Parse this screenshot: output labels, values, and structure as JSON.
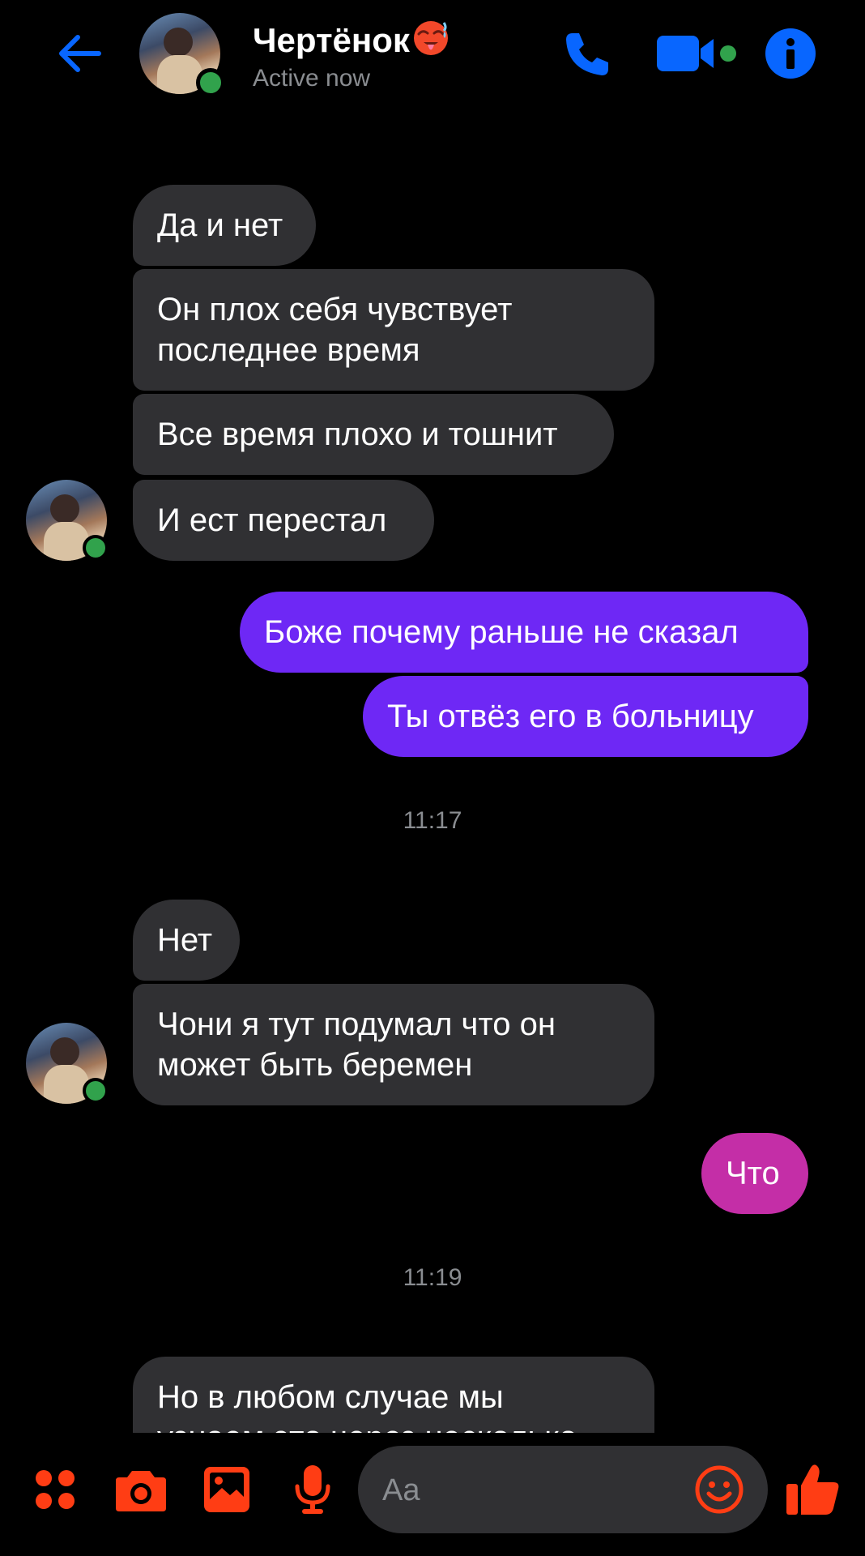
{
  "colors": {
    "accent_blue": "#0866ff",
    "accent_orange": "#ff3d14",
    "bubble_incoming": "#303033",
    "bubble_outgoing_blue": "#6e28f5",
    "bubble_outgoing_pink": "#c42ea7",
    "status_online": "#31a24c"
  },
  "header": {
    "contact_name": "Чертёнок",
    "contact_emoji": "hot-face-emoji",
    "status": "Active now",
    "icons": [
      "back-arrow-icon",
      "phone-icon",
      "video-camera-icon",
      "info-icon"
    ]
  },
  "messages": [
    {
      "direction": "in",
      "text": "Да и нет"
    },
    {
      "direction": "in",
      "lines": [
        "Он плох себя чувствует",
        "последнее время"
      ]
    },
    {
      "direction": "in",
      "text": "Все время плохо и тошнит"
    },
    {
      "direction": "in",
      "text": "И ест перестал"
    },
    {
      "direction": "out",
      "text": "Боже почему раньше не сказал"
    },
    {
      "direction": "out",
      "text": "Ты отвёз его в больницу"
    },
    {
      "timestamp": "11:17"
    },
    {
      "direction": "in",
      "text": "Нет"
    },
    {
      "direction": "in",
      "lines": [
        "Чони я тут подумал что он",
        "может быть беремен"
      ]
    },
    {
      "direction": "out",
      "text": "Что"
    },
    {
      "timestamp": "11:19"
    },
    {
      "direction": "in",
      "lines": [
        "Но в любом случае мы",
        "узнаем это через несколько"
      ]
    }
  ],
  "composer": {
    "placeholder": "Aa",
    "icons": [
      "apps-icon",
      "camera-icon",
      "gallery-icon",
      "microphone-icon",
      "emoji-icon",
      "thumbs-up-icon"
    ]
  }
}
